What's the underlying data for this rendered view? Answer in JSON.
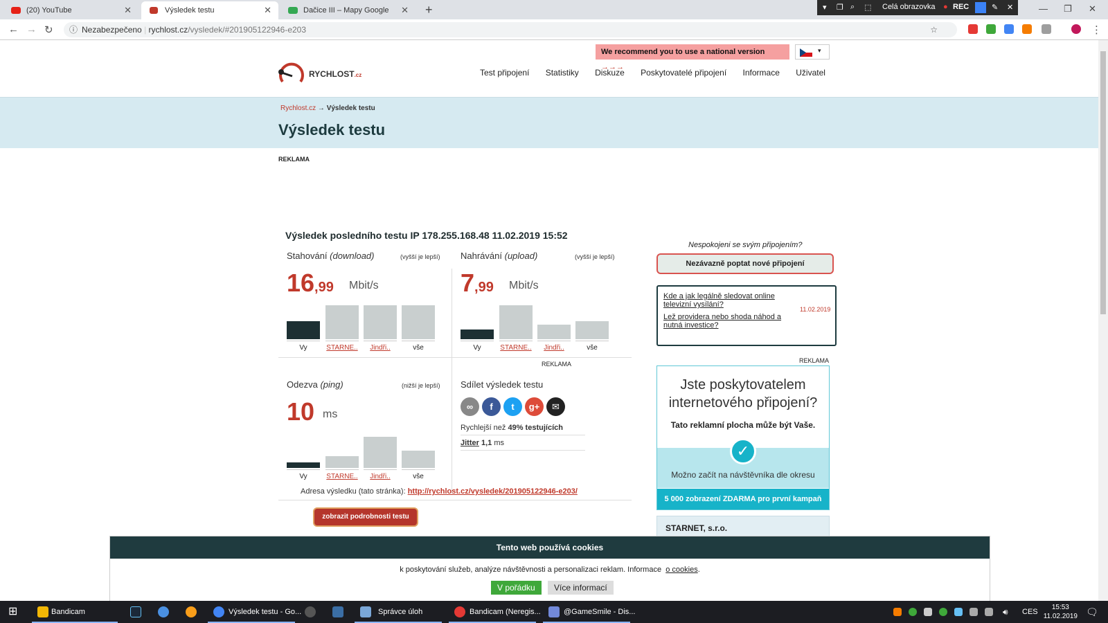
{
  "browser": {
    "tabs": [
      {
        "label": "(20) YouTube"
      },
      {
        "label": "Výsledek testu"
      },
      {
        "label": "Dačice III – Mapy Google"
      }
    ],
    "new_tab": "+",
    "address": {
      "security": "Nezabezpečeno",
      "domain": "rychlost.cz",
      "path": "/vysledek/#201905122946-e203"
    },
    "recorder": {
      "mode": "Celá obrazovka",
      "rec": "REC"
    }
  },
  "header": {
    "national_banner": "We recommend you to use a national version",
    "national_arrows": "→→→",
    "logo_text": "RYCHLOST",
    "logo_suffix": ".cz",
    "nav": [
      "Test připojení",
      "Statistiky",
      "Diskuze",
      "Poskytovatelé připojení",
      "Informace",
      "Uživatel"
    ]
  },
  "hero": {
    "crumb_home": "Rychlost.cz",
    "crumb_arrow": "→",
    "crumb_current": "Výsledek testu",
    "title": "Výsledek testu"
  },
  "ad_label": "REKLAMA",
  "result": {
    "title": "Výsledek posledního testu IP 178.255.168.48 11.02.2019 15:52",
    "download": {
      "label": "Stahování",
      "sub": "(download)",
      "hint": "(vyšší je lepší)",
      "int": "16",
      "dec": ",99",
      "unit": "Mbit/s"
    },
    "upload": {
      "label": "Nahrávání",
      "sub": "(upload)",
      "hint": "(vyšší je lepší)",
      "int": "7",
      "dec": ",99",
      "unit": "Mbit/s"
    },
    "ping": {
      "label": "Odezva",
      "sub": "(ping)",
      "hint": "(nižší je lepší)",
      "int": "10",
      "unit": "ms"
    },
    "bar_labels": [
      "Vy",
      "STARNE..",
      "Jindři..",
      "vše"
    ],
    "download_levels": [
      0.35,
      0.65,
      0.65,
      0.65
    ],
    "upload_levels": [
      0.18,
      0.65,
      0.28,
      0.35
    ],
    "ping_levels": [
      0.1,
      0.22,
      0.6,
      0.33
    ],
    "share_title": "Sdílet výsledek testu",
    "faster_prefix": "Rychlejší než",
    "faster_value": "49% testujících",
    "jitter_label": "Jitter",
    "jitter_value": "1,1",
    "jitter_unit": "ms",
    "address_label": "Adresa výsledku (tato stránka):",
    "address_link": "http://rychlost.cz/vysledek/201905122946-e203/",
    "details_button": "zobrazit podrobnosti testu"
  },
  "sidebar": {
    "question": "Nespokojeni se svým připojením?",
    "request_button": "Nezávazně poptat nové připojení",
    "news": [
      {
        "title": "Kde a jak legálně sledovat online televizní vysílání?",
        "date": "11.02.2019"
      },
      {
        "title": "Lež providera nebo shoda náhod a nutná investice?"
      }
    ],
    "ad": {
      "heading": "Jste poskytovatelem internetového připojení?",
      "sub": "Tato reklamní plocha může být Vaše.",
      "line": "Možno začít na návštěvníka dle okresu",
      "footer": "5 000 zobrazení ZDARMA pro první kampaň"
    },
    "provider": "STARNET, s.r.o."
  },
  "cookie": {
    "title": "Tento web používá cookies",
    "text": "k poskytování služeb, analýze návštěvnosti a personalizaci reklam. Informace",
    "link": "o cookies",
    "ok": "V pořádku",
    "more": "Více informací"
  },
  "taskbar": {
    "items": [
      "Bandicam",
      "Výsledek testu - Go...",
      "Správce úloh",
      "Bandicam (Neregis...",
      "@GameSmile - Dis..."
    ],
    "lang": "CES",
    "time": "15:53",
    "date": "11.02.2019"
  },
  "colors": {
    "accent": "#c0392b",
    "dark": "#1d3b3f",
    "hero": "#d6eaf1"
  }
}
